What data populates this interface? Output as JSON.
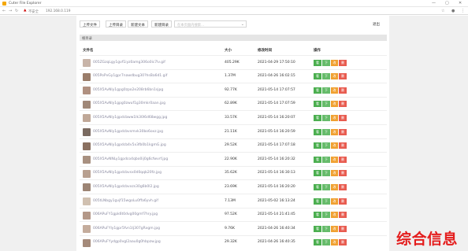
{
  "window": {
    "tab_title": "Cuter File Explorer",
    "controls": [
      "—",
      "▢",
      "✕"
    ]
  },
  "address": {
    "not_secure": "不安全",
    "url": "192.168.0.119"
  },
  "toolbar": {
    "upload_file": "上传文件",
    "upload_dir": "上传目录",
    "new_file": "新建文本",
    "new_dir": "新建目录",
    "search_placeholder": "在本页面内搜索...",
    "logout": "退出"
  },
  "breadcrumb": "根目录",
  "table": {
    "headers": {
      "name": "文件名",
      "size": "大小",
      "mtime": "修改时间",
      "ops": "操作"
    },
    "rows": [
      {
        "name": "005ZGzqLgy1gvf1iyz0amg306o0ic7lv.gif",
        "size": "405.29K",
        "time": "2021-04-29 17:50:10",
        "thumb": "#c8b4a8"
      },
      {
        "name": "005PoPvGy1gpr7nawdbug30?hsBa6d1.gif",
        "size": "1.37M",
        "time": "2021-04-26 16:02:15",
        "thumb": "#9a7d6a"
      },
      {
        "name": "005X5AvNly1gpg0zpo2e208rb6bn1sjpg",
        "size": "92.77K",
        "time": "2021-05-14 17:07:57",
        "thumb": "#b09080"
      },
      {
        "name": "005X5AvNly1gpg0zwuf1g30mkr0aan.jpg",
        "size": "62.89K",
        "time": "2021-05-14 17:07:59",
        "thumb": "#a08878"
      },
      {
        "name": "005X5AvNly1gpdcbww1lk30l6d68wgg.jpg",
        "size": "33.57K",
        "time": "2021-05-14 16:20:07",
        "thumb": "#c0a898"
      },
      {
        "name": "005X5AvNly1gpdcbvsmvk30bo6oxz.jpg",
        "size": "21.11K",
        "time": "2021-05-14 16:20:59",
        "thumb": "#7a6a60"
      },
      {
        "name": "005X5AvNly1gpdcb4v5x3fb0b1kgmG.jpg",
        "size": "29.52K",
        "time": "2021-05-14 17:07:18",
        "thumb": "#8a7060"
      },
      {
        "name": "005X5AvNNLy1gpdco4qbo0ij0g6cfwvrf.jpg",
        "size": "22.90K",
        "time": "2021-05-14 16:20:32",
        "thumb": "#a89080"
      },
      {
        "name": "005X5AvNly1gpdcbvsx0d0qqb20fz.jpg",
        "size": "35.62K",
        "time": "2021-05-14 16:30:13",
        "thumb": "#b8a090"
      },
      {
        "name": "005X5AvNly1gpdcbvxzs30g6b0l2.jpg",
        "size": "23.69K",
        "time": "2021-05-14 16:20:20",
        "thumb": "#9c8474"
      },
      {
        "name": "005tLNbgy1gvjf15wgoLu0ffa6yvh.gif",
        "size": "7.13M",
        "time": "2021-05-02 16:13:24",
        "thumb": "#d0c0b0"
      },
      {
        "name": "006APuFY1gpk6t0dvg00gmf7hry.jpg",
        "size": "97.52K",
        "time": "2021-05-14 21:41:45",
        "thumb": "#b49888"
      },
      {
        "name": "006APuFYly1gpr5fvn1lj307gRxgm.jpg",
        "size": "9.76K",
        "time": "2021-04-26 16:40:34",
        "thumb": "#c4ac9c"
      },
      {
        "name": "006APuFYydgp0vgl2aau0g0hbpzw.jpg",
        "size": "29.32K",
        "time": "2021-04-26 16:40:35",
        "thumb": "#a48a7a"
      }
    ],
    "action_labels": {
      "view": "看",
      "download": "下",
      "rename": "改",
      "delete": "删"
    }
  },
  "watermark": "综合信息"
}
